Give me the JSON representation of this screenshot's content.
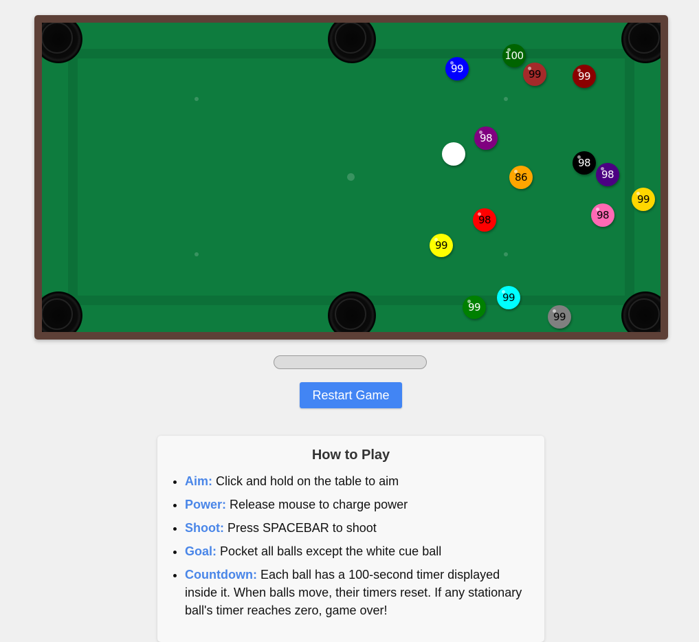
{
  "balls": [
    {
      "id": "cue",
      "color": "#ffffff",
      "text_color": "#000000",
      "label": ""
    },
    {
      "id": "blue",
      "color": "#0000ff",
      "text_color": "#ffffff",
      "label": "99"
    },
    {
      "id": "darkgreen",
      "color": "#006400",
      "text_color": "#ffffff",
      "label": "100"
    },
    {
      "id": "brown",
      "color": "#a52a2a",
      "text_color": "#000000",
      "label": "99"
    },
    {
      "id": "darkred",
      "color": "#8b0000",
      "text_color": "#ffffff",
      "label": "99"
    },
    {
      "id": "purple",
      "color": "#800080",
      "text_color": "#ffffff",
      "label": "98"
    },
    {
      "id": "orange",
      "color": "#ffa500",
      "text_color": "#000000",
      "label": "86"
    },
    {
      "id": "black",
      "color": "#000000",
      "text_color": "#ffffff",
      "label": "98"
    },
    {
      "id": "indigo",
      "color": "#4b0082",
      "text_color": "#ffffff",
      "label": "98"
    },
    {
      "id": "gold",
      "color": "#ffd700",
      "text_color": "#000000",
      "label": "99"
    },
    {
      "id": "hotpink",
      "color": "#ff69b4",
      "text_color": "#000000",
      "label": "98"
    },
    {
      "id": "red",
      "color": "#ff0000",
      "text_color": "#000000",
      "label": "98"
    },
    {
      "id": "yellow",
      "color": "#ffff00",
      "text_color": "#000000",
      "label": "99"
    },
    {
      "id": "cyan",
      "color": "#00ffff",
      "text_color": "#000000",
      "label": "99"
    },
    {
      "id": "green",
      "color": "#008000",
      "text_color": "#ffffff",
      "label": "99"
    },
    {
      "id": "gray",
      "color": "#808080",
      "text_color": "#000000",
      "label": "99"
    }
  ],
  "controls": {
    "restart_label": "Restart Game"
  },
  "instructions": {
    "title": "How to Play",
    "items": [
      {
        "term": "Aim:",
        "text": "Click and hold on the table to aim"
      },
      {
        "term": "Power:",
        "text": "Release mouse to charge power"
      },
      {
        "term": "Shoot:",
        "text": "Press SPACEBAR to shoot"
      },
      {
        "term": "Goal:",
        "text": "Pocket all balls except the white cue ball"
      },
      {
        "term": "Countdown:",
        "text": "Each ball has a 100-second timer displayed inside it. When balls move, their timers reset. If any stationary ball's timer reaches zero, game over!"
      }
    ]
  },
  "colors": {
    "felt": "#0e7c3e",
    "frame": "#5d4037",
    "accent": "#4285f4"
  }
}
